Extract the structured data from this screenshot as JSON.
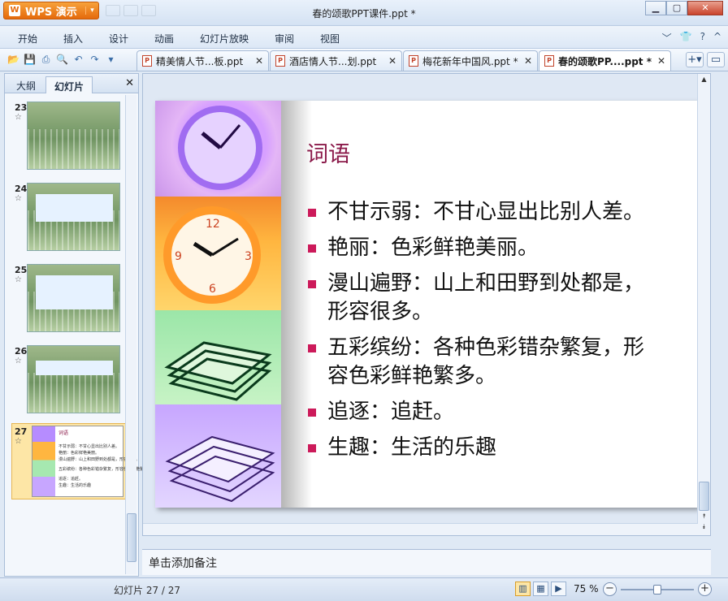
{
  "app": {
    "name": "WPS 演示",
    "window_title": "春的颂歌PPT课件.ppt *"
  },
  "menu": {
    "tabs": [
      "开始",
      "插入",
      "设计",
      "动画",
      "幻灯片放映",
      "审阅",
      "视图"
    ]
  },
  "doc_tabs": [
    {
      "label": "精美情人节...板.ppt",
      "active": false
    },
    {
      "label": "酒店情人节...划.ppt",
      "active": false
    },
    {
      "label": "梅花新年中国风.ppt *",
      "active": false
    },
    {
      "label": "春的颂歌PP....ppt *",
      "active": true
    }
  ],
  "left_panel": {
    "tabs": [
      "大纲",
      "幻灯片"
    ],
    "active_tab": "幻灯片",
    "thumbnails": [
      {
        "number": "23"
      },
      {
        "number": "24"
      },
      {
        "number": "25"
      },
      {
        "number": "26"
      },
      {
        "number": "27",
        "selected": true
      }
    ]
  },
  "slide": {
    "title": "词语",
    "bullets": [
      "不甘示弱：不甘心显出比别人差。",
      "艳丽：色彩鲜艳美丽。",
      "漫山遍野：山上和田野到处都是，形容很多。",
      "五彩缤纷：各种色彩错杂繁复，形容色彩鲜艳繁多。",
      "追逐：追赶。",
      "生趣：生活的乐趣"
    ],
    "accent_color": "#cc1a5a",
    "title_color": "#8b1a4a"
  },
  "notes": {
    "placeholder": "单击添加备注"
  },
  "status": {
    "slide_info": "幻灯片 27 / 27",
    "zoom": "75 %",
    "zoom_value": 0.75
  }
}
